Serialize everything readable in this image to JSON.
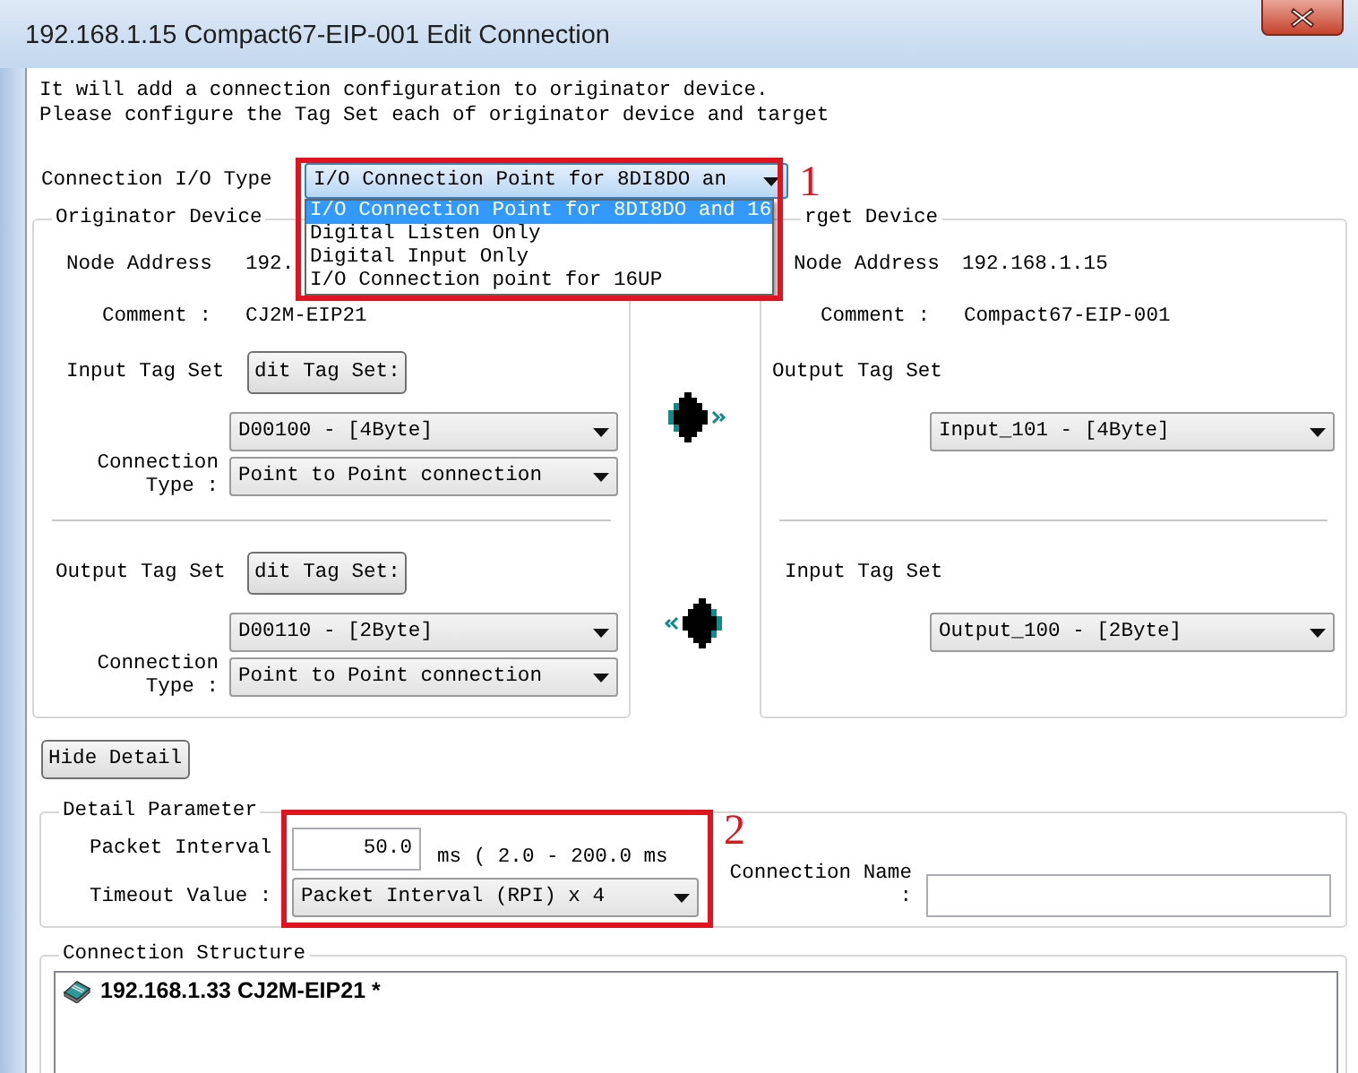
{
  "window": {
    "title": "192.168.1.15 Compact67-EIP-001 Edit Connection"
  },
  "intro": [
    "It will add a connection configuration to originator device.",
    "Please configure the Tag Set each of originator device and target"
  ],
  "io_type": {
    "label": "Connection I/O Type",
    "value": "I/O Connection Point for 8DI8DO an",
    "expanded": true,
    "options": [
      {
        "label": "I/O Connection Point for 8DI8DO and 16",
        "selected": true
      },
      {
        "label": "Digital Listen Only",
        "selected": false
      },
      {
        "label": "Digital Input Only",
        "selected": false
      },
      {
        "label": "I/O Connection point for 16UP",
        "selected": false
      }
    ]
  },
  "originator": {
    "legend": "Originator Device",
    "node_address_label": "Node Address",
    "node_address": "192.",
    "comment_label": "Comment :",
    "comment": "CJ2M-EIP21",
    "sections": [
      {
        "tag_set_label": "Input Tag Set",
        "edit_button": "dit Tag Set:",
        "tag_set": "D00100 - [4Byte]",
        "connection_type_label": "Connection Type :",
        "connection_type": "Point to Point connection"
      },
      {
        "tag_set_label": "Output Tag Set",
        "edit_button": "dit Tag Set:",
        "tag_set": "D00110 - [2Byte]",
        "connection_type_label": "Connection Type :",
        "connection_type": "Point to Point connection"
      }
    ]
  },
  "arrows": [
    {
      "kind": "outgoing"
    },
    {
      "kind": "incoming"
    }
  ],
  "target": {
    "legend": "rget Device",
    "node_address_label": "Node Address",
    "node_address": "192.168.1.15",
    "comment_label": "Comment :",
    "comment": "Compact67-EIP-001",
    "sections": [
      {
        "tag_set_label": "Output Tag Set",
        "tag_set": "Input_101 - [4Byte]"
      },
      {
        "tag_set_label": "Input Tag Set",
        "tag_set": "Output_100 - [2Byte]"
      }
    ]
  },
  "hide_detail_button": "Hide Detail",
  "detail": {
    "legend": "Detail Parameter",
    "packet_interval_label": "Packet Interval",
    "packet_interval": "50.0",
    "range": "ms ( 2.0 - 200.0 ms",
    "timeout_label": "Timeout Value :",
    "timeout": "Packet Interval (RPI) x 4",
    "connection_name_label": "Connection Name :"
  },
  "structure": {
    "legend": "Connection Structure",
    "items": [
      {
        "label": "192.168.1.33 CJ2M-EIP21 *"
      }
    ]
  },
  "annotations": [
    {
      "label": "1"
    },
    {
      "label": "2"
    }
  ]
}
